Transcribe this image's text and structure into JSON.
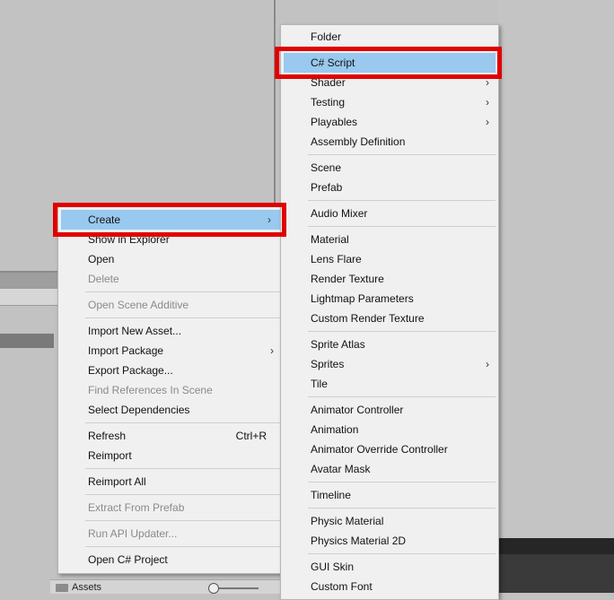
{
  "context_menu": {
    "items": [
      {
        "label": "Create",
        "has_submenu": true,
        "highlighted": true
      },
      {
        "label": "Show in Explorer"
      },
      {
        "label": "Open"
      },
      {
        "label": "Delete",
        "disabled": true
      },
      {
        "label": "Open Scene Additive",
        "disabled": true
      },
      {
        "label": "Import New Asset..."
      },
      {
        "label": "Import Package",
        "has_submenu": true
      },
      {
        "label": "Export Package..."
      },
      {
        "label": "Find References In Scene",
        "disabled": true
      },
      {
        "label": "Select Dependencies"
      },
      {
        "label": "Refresh",
        "shortcut": "Ctrl+R"
      },
      {
        "label": "Reimport"
      },
      {
        "label": "Reimport All"
      },
      {
        "label": "Extract From Prefab",
        "disabled": true
      },
      {
        "label": "Run API Updater...",
        "disabled": true
      },
      {
        "label": "Open C# Project"
      }
    ]
  },
  "create_submenu": {
    "items": [
      {
        "label": "Folder"
      },
      {
        "label": "C# Script",
        "highlighted": true
      },
      {
        "label": "Shader",
        "has_submenu": true
      },
      {
        "label": "Testing",
        "has_submenu": true
      },
      {
        "label": "Playables",
        "has_submenu": true
      },
      {
        "label": "Assembly Definition"
      },
      {
        "label": "Scene"
      },
      {
        "label": "Prefab"
      },
      {
        "label": "Audio Mixer"
      },
      {
        "label": "Material"
      },
      {
        "label": "Lens Flare"
      },
      {
        "label": "Render Texture"
      },
      {
        "label": "Lightmap Parameters"
      },
      {
        "label": "Custom Render Texture"
      },
      {
        "label": "Sprite Atlas"
      },
      {
        "label": "Sprites",
        "has_submenu": true
      },
      {
        "label": "Tile"
      },
      {
        "label": "Animator Controller"
      },
      {
        "label": "Animation"
      },
      {
        "label": "Animator Override Controller"
      },
      {
        "label": "Avatar Mask"
      },
      {
        "label": "Timeline"
      },
      {
        "label": "Physic Material"
      },
      {
        "label": "Physics Material 2D"
      },
      {
        "label": "GUI Skin"
      },
      {
        "label": "Custom Font"
      }
    ]
  },
  "project_panel": {
    "folder_label": "Assets"
  },
  "symbols": {
    "submenu_arrow": "›"
  },
  "colors": {
    "highlight": "#99c9ef",
    "annotation_red": "#e00000",
    "menu_bg": "#f0f0f0"
  }
}
